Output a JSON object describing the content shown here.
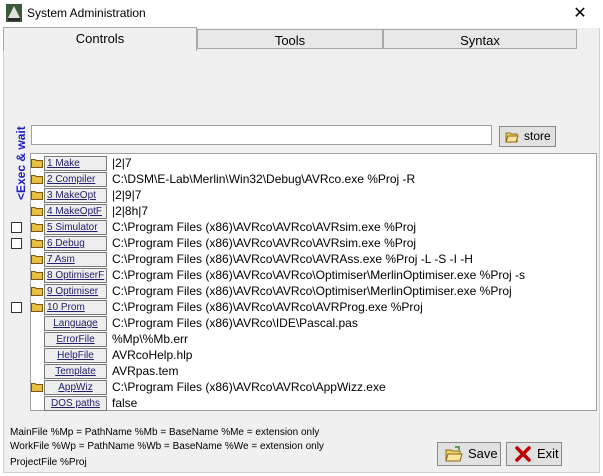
{
  "window": {
    "title": "System Administration",
    "close_glyph": "✕"
  },
  "tabs": [
    {
      "label": "Controls",
      "active": true
    },
    {
      "label": "Tools",
      "active": false
    },
    {
      "label": "Syntax",
      "active": false
    }
  ],
  "exec_wait_label": "<Exec & wait",
  "command_input": {
    "value": ""
  },
  "store_label": "store",
  "rows": [
    {
      "checkbox": false,
      "folder": true,
      "button": "1 Make",
      "value": "|2|7"
    },
    {
      "checkbox": false,
      "folder": true,
      "button": "2 Compiler",
      "value": "C:\\DSM\\E-Lab\\Merlin\\Win32\\Debug\\AVRco.exe %Proj -R"
    },
    {
      "checkbox": false,
      "folder": true,
      "button": "3 MakeOpt",
      "value": "|2|9|7"
    },
    {
      "checkbox": false,
      "folder": true,
      "button": "4 MakeOptF",
      "value": "|2|8h|7"
    },
    {
      "checkbox": true,
      "folder": true,
      "button": "5 Simulator",
      "value": "C:\\Program Files (x86)\\AVRco\\AVRco\\AVRsim.exe %Proj"
    },
    {
      "checkbox": true,
      "folder": true,
      "button": "6 Debug",
      "value": "C:\\Program Files (x86)\\AVRco\\AVRco\\AVRsim.exe %Proj"
    },
    {
      "checkbox": false,
      "folder": true,
      "button": "7 Asm",
      "value": "C:\\Program Files (x86)\\AVRco\\AVRco\\AVRAss.exe %Proj -L -S -I -H"
    },
    {
      "checkbox": false,
      "folder": true,
      "button": "8 OptimiserF",
      "value": "C:\\Program Files (x86)\\AVRco\\AVRco\\Optimiser\\MerlinOptimiser.exe %Proj -s"
    },
    {
      "checkbox": false,
      "folder": true,
      "button": "9 Optimiser",
      "value": "C:\\Program Files (x86)\\AVRco\\AVRco\\Optimiser\\MerlinOptimiser.exe %Proj"
    },
    {
      "checkbox": true,
      "folder": true,
      "button": "10 Prom",
      "value": "C:\\Program Files (x86)\\AVRco\\AVRco\\AVRProg.exe %Proj"
    },
    {
      "checkbox": false,
      "folder": false,
      "button": "Language",
      "value": "C:\\Program Files (x86)\\AVRco\\IDE\\Pascal.pas"
    },
    {
      "checkbox": false,
      "folder": false,
      "button": "ErrorFile",
      "value": "%Mp\\%Mb.err"
    },
    {
      "checkbox": false,
      "folder": false,
      "button": "HelpFile",
      "value": "AVRcoHelp.hlp"
    },
    {
      "checkbox": false,
      "folder": false,
      "button": "Template",
      "value": "AVRpas.tem"
    },
    {
      "checkbox": false,
      "folder": true,
      "button": "AppWiz",
      "value": "C:\\Program Files (x86)\\AVRco\\AVRco\\AppWizz.exe"
    },
    {
      "checkbox": false,
      "folder": false,
      "button": "DOS paths",
      "value": "false"
    }
  ],
  "info_lines": [
    "MainFile %Mp = PathName  %Mb = BaseName  %Me = extension only",
    "WorkFile %Wp = PathName  %Wb = BaseName  %We = extension only",
    "ProjectFile %Proj"
  ],
  "save_label": "Save",
  "exit_label": "Exit",
  "colors": {
    "exec_wait": "#1d1dc8",
    "folder": "#e8c040",
    "exit_icon": "#c00000",
    "button_text": "#202070"
  }
}
